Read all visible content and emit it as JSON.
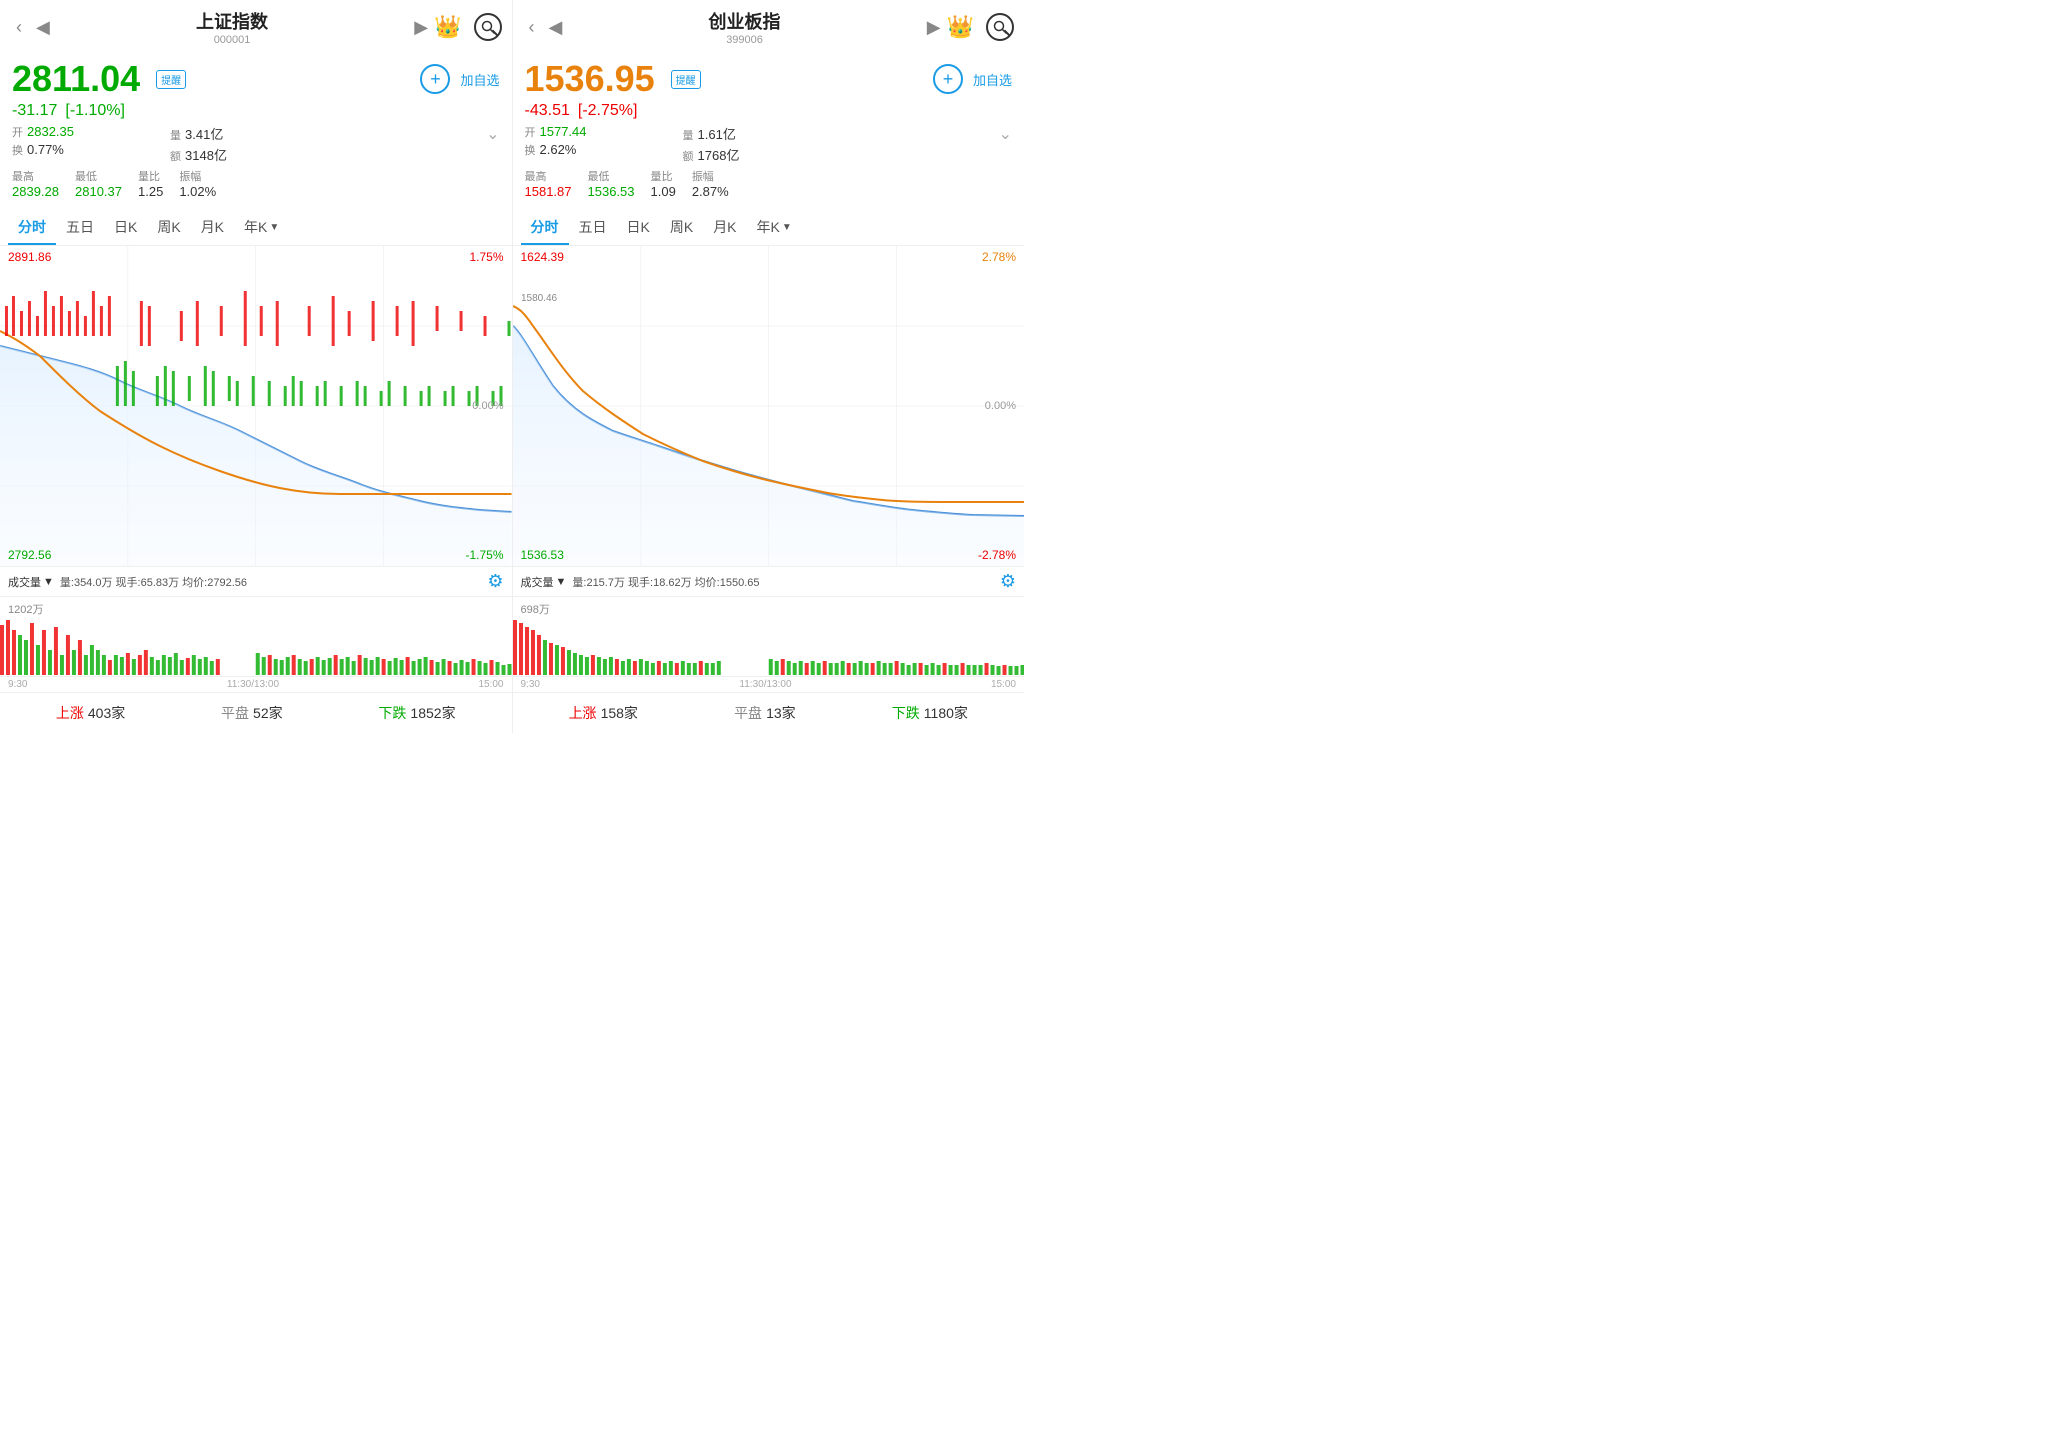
{
  "left": {
    "title": "上证指数",
    "code": "000001",
    "mainPrice": "2811.04",
    "alertLabel": "提醒",
    "addWatchLabel": "加自选",
    "change": "-31.17",
    "changePct": "[-1.10%]",
    "open": "2832.35",
    "volume": "3.41亿",
    "turnoverRate": "0.77%",
    "amount": "3148亿",
    "high": "2839.28",
    "low": "2810.37",
    "volRatio": "1.25",
    "amplitude": "1.02%",
    "openLabel": "开",
    "volLabel": "量",
    "turnLabel": "换",
    "amtLabel": "额",
    "highLabel": "最高",
    "lowLabel": "最低",
    "volRatioLabel": "量比",
    "ampLabel": "振幅",
    "tabs": [
      "分时",
      "五日",
      "日K",
      "周K",
      "月K",
      "年K"
    ],
    "activeTab": "分时",
    "chartTopLeft": "2891.86",
    "chartTopRight": "1.75%",
    "chartMidRight": "0.00%",
    "chartBottomLeft": "2792.56",
    "chartBottomRight": "-1.75%",
    "volBarLabel": "成交量",
    "volDetails": "量:354.0万  现手:65.83万  均价:2792.56",
    "volMax": "1202万",
    "times": [
      "9:30",
      "11:30/13:00",
      "15:00"
    ],
    "statsUp": "上涨",
    "statsUpCount": "403家",
    "statsFlat": "平盘",
    "statsFlatCount": "52家",
    "statsDown": "下跌",
    "statsDownCount": "1852家"
  },
  "right": {
    "title": "创业板指",
    "code": "399006",
    "mainPrice": "1536.95",
    "alertLabel": "提醒",
    "addWatchLabel": "加自选",
    "change": "-43.51",
    "changePct": "[-2.75%]",
    "open": "1577.44",
    "volume": "1.61亿",
    "turnoverRate": "2.62%",
    "amount": "1768亿",
    "high": "1581.87",
    "low": "1536.53",
    "volRatio": "1.09",
    "amplitude": "2.87%",
    "openLabel": "开",
    "volLabel": "量",
    "turnLabel": "换",
    "amtLabel": "额",
    "highLabel": "最高",
    "lowLabel": "最低",
    "volRatioLabel": "量比",
    "ampLabel": "振幅",
    "tabs": [
      "分时",
      "五日",
      "日K",
      "周K",
      "月K",
      "年K"
    ],
    "activeTab": "分时",
    "chartTopLeft": "1624.39",
    "chartTopRight": "2.78%",
    "chartMidRight": "0.00%",
    "chartBottomLeft": "1536.53",
    "chartBottomRight": "-2.78%",
    "volBarLabel": "成交量",
    "volDetails": "量:215.7万  现手:18.62万  均价:1550.65",
    "volMax": "698万",
    "times": [
      "9:30",
      "11:30/13:00",
      "15:00"
    ],
    "statsUp": "上涨",
    "statsUpCount": "158家",
    "statsFlat": "平盘",
    "statsFlatCount": "13家",
    "statsDown": "下跌",
    "statsDownCount": "1180家"
  },
  "icons": {
    "crown": "👑",
    "settings": "⚙"
  }
}
